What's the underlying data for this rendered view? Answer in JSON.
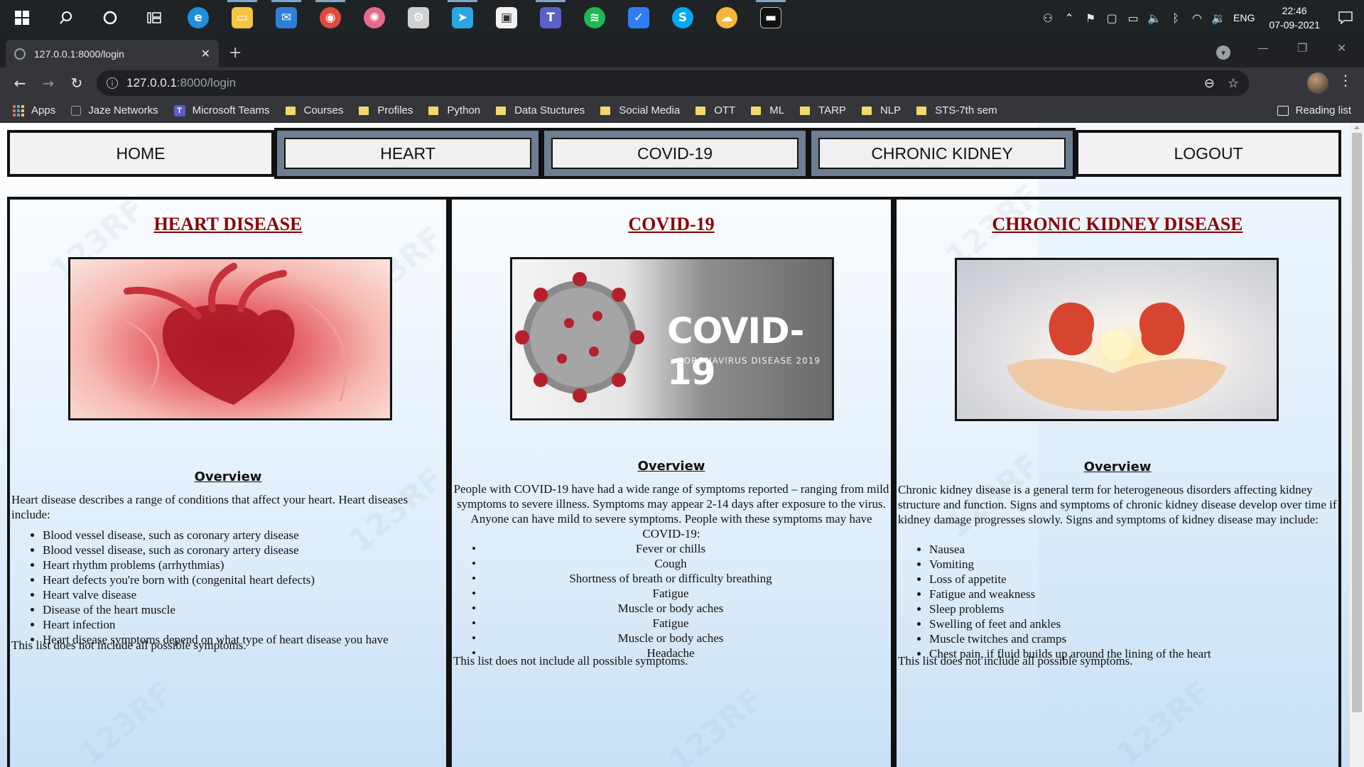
{
  "taskbar": {
    "apps": [
      {
        "name": "windows-start",
        "glyph": "",
        "color": "#ffffff"
      },
      {
        "name": "search",
        "glyph": "",
        "color": "#ffffff"
      },
      {
        "name": "cortana",
        "glyph": "",
        "color": "#ffffff"
      },
      {
        "name": "task-view",
        "glyph": "",
        "color": "#ffffff"
      },
      {
        "name": "edge",
        "glyph": "e",
        "color": "#1e8fd8"
      },
      {
        "name": "file-explorer",
        "glyph": "▭",
        "color": "#f4c543"
      },
      {
        "name": "mail",
        "glyph": "✉",
        "color": "#2d7fd6"
      },
      {
        "name": "chrome",
        "glyph": "◉",
        "color": "#e04a3b"
      },
      {
        "name": "pinwheel-app",
        "glyph": "✺",
        "color": "#e86a8e"
      },
      {
        "name": "settings",
        "glyph": "⚙",
        "color": "#d0d0d0"
      },
      {
        "name": "telegram",
        "glyph": "➤",
        "color": "#2ca5e0"
      },
      {
        "name": "store",
        "glyph": "▣",
        "color": "#f2f2f2"
      },
      {
        "name": "teams",
        "glyph": "T",
        "color": "#5b5fc7"
      },
      {
        "name": "spotify",
        "glyph": "≋",
        "color": "#1db954"
      },
      {
        "name": "todo",
        "glyph": "✓",
        "color": "#2f7cf6"
      },
      {
        "name": "skype",
        "glyph": "S",
        "color": "#00a9f0"
      },
      {
        "name": "weather",
        "glyph": "☁",
        "color": "#f6b73c"
      },
      {
        "name": "terminal",
        "glyph": "▬",
        "color": "#111111"
      }
    ],
    "language": "ENG",
    "time": "22:46",
    "date": "07-09-2021"
  },
  "browser": {
    "tab_title": "127.0.0.1:8000/login",
    "url_host": "127.0.0.1",
    "url_path": ":8000/login",
    "bookmarks": [
      {
        "label": "Apps",
        "icon": "apps"
      },
      {
        "label": "Jaze Networks",
        "icon": "square"
      },
      {
        "label": "Microsoft Teams",
        "icon": "teams"
      },
      {
        "label": "Courses",
        "icon": "folder"
      },
      {
        "label": "Profiles",
        "icon": "folder"
      },
      {
        "label": "Python",
        "icon": "folder"
      },
      {
        "label": "Data Stuctures",
        "icon": "folder"
      },
      {
        "label": "Social Media",
        "icon": "folder"
      },
      {
        "label": "OTT",
        "icon": "folder"
      },
      {
        "label": "ML",
        "icon": "folder"
      },
      {
        "label": "TARP",
        "icon": "folder"
      },
      {
        "label": "NLP",
        "icon": "folder"
      },
      {
        "label": "STS-7th sem",
        "icon": "folder"
      }
    ],
    "reading_list": "Reading list"
  },
  "page": {
    "nav": {
      "home": "HOME",
      "heart": "HEART",
      "covid": "COVID-19",
      "kidney": "CHRONIC KIDNEY",
      "logout": "LOGOUT"
    },
    "watermark": "123RF",
    "heart": {
      "title": "HEART DISEASE",
      "overview": "Overview",
      "intro": "Heart disease describes a range of conditions that affect your heart. Heart diseases include:",
      "items": [
        "Blood vessel disease, such as coronary artery disease",
        "Blood vessel disease, such as coronary artery disease",
        "Heart rhythm problems (arrhythmias)",
        "Heart defects you're born with (congenital heart defects)",
        "Heart valve disease",
        "Disease of the heart muscle",
        "Heart infection",
        "Heart disease symptoms depend on what type of heart disease you have"
      ],
      "footer": "This list does not include all possible symptoms."
    },
    "covid": {
      "title": "COVID-19",
      "overview": "Overview",
      "image_title": "COVID-19",
      "image_subtitle": "CORONAVIRUS DISEASE 2019",
      "intro": "People with COVID-19 have had a wide range of symptoms reported – ranging from mild symptoms to severe illness. Symptoms may appear 2-14 days after exposure to the virus. Anyone can have mild to severe symptoms. People with these symptoms may have COVID-19:",
      "items": [
        "Fever or chills",
        "Cough",
        "Shortness of breath or difficulty breathing",
        "Fatigue",
        "Muscle or body aches",
        "Fatigue",
        "Muscle or body aches",
        "Headache"
      ],
      "footer": "This list does not include all possible symptoms."
    },
    "kidney": {
      "title": "CHRONIC KIDNEY DISEASE",
      "overview": "Overview",
      "intro": "Chronic kidney disease is a general term for heterogeneous disorders affecting kidney structure and function. Signs and symptoms of chronic kidney disease develop over time if kidney damage progresses slowly. Signs and symptoms of kidney disease may include:",
      "items": [
        "Nausea",
        "Vomiting",
        "Loss of appetite",
        "Fatigue and weakness",
        "Sleep problems",
        "Swelling of feet and ankles",
        "Muscle twitches and cramps",
        "Chest pain, if fluid builds up around the lining of the heart"
      ],
      "footer": "This list does not include all possible symptoms."
    }
  }
}
